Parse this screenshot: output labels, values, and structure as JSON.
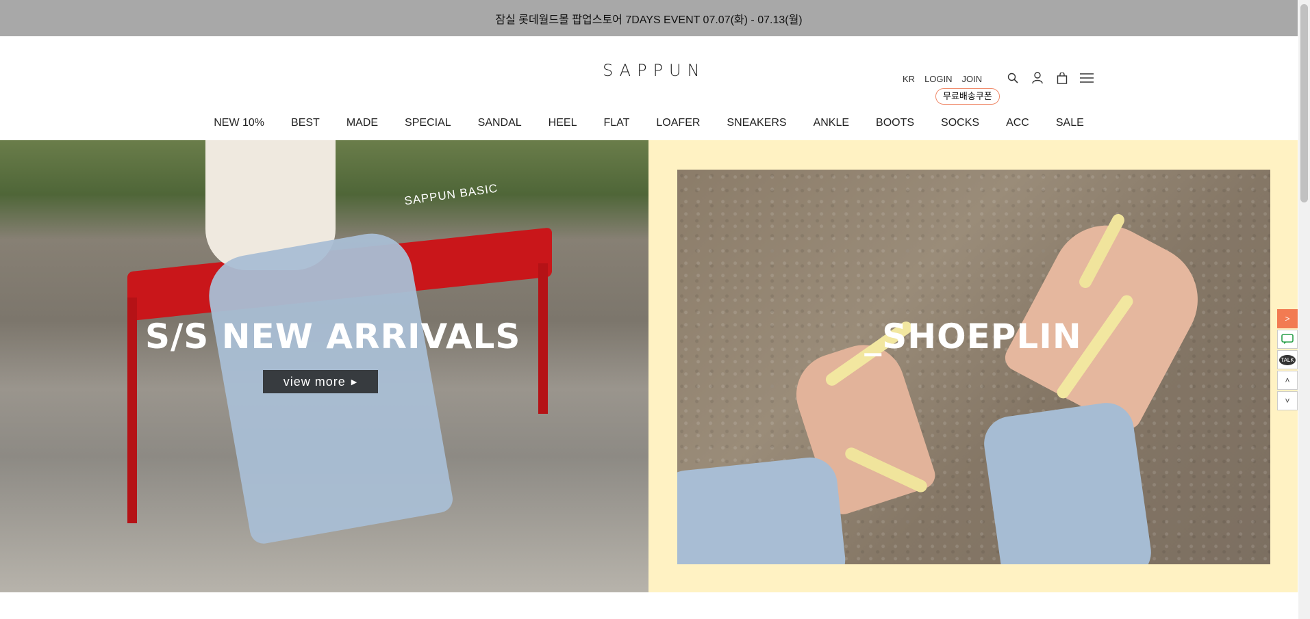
{
  "topbar": {
    "notice": "잠실 롯데월드몰 팝업스토어 7DAYS EVENT 07.07(화) - 07.13(월)"
  },
  "header": {
    "logo": "SAPPUN",
    "util": {
      "lang": "KR",
      "login": "LOGIN",
      "join": "JOIN"
    },
    "coupon": "무료배송쿠폰",
    "icons": [
      "search-icon",
      "user-icon",
      "cart-icon",
      "menu-icon"
    ]
  },
  "nav": {
    "items": [
      "NEW 10%",
      "BEST",
      "MADE",
      "SPECIAL",
      "SANDAL",
      "HEEL",
      "FLAT",
      "LOAFER",
      "SNEAKERS",
      "ANKLE",
      "BOOTS",
      "SOCKS",
      "ACC",
      "SALE"
    ]
  },
  "hero": {
    "left": {
      "brand_tag": "SAPPUN BASIC",
      "title": "S/S NEW ARRIVALS",
      "button": "view more"
    },
    "right": {
      "title": "_SHOEPLIN"
    }
  },
  "side_tabs": {
    "next": ">",
    "chat": "",
    "talk": "TALK",
    "up": "˄",
    "down": "˅"
  },
  "colors": {
    "topbar": "#a8a8a8",
    "panel_right_bg": "#fff2c3",
    "accent": "#f27b52"
  }
}
